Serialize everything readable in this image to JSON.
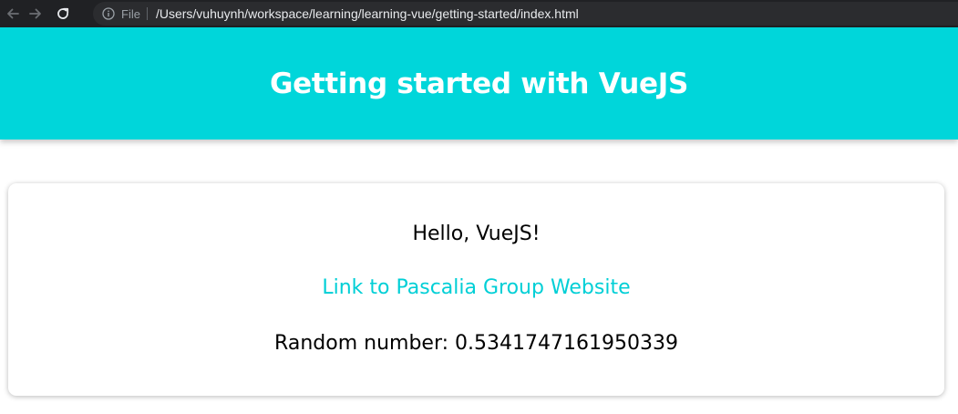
{
  "browser": {
    "scheme_label": "File",
    "url": "/Users/vuhuynh/workspace/learning/learning-vue/getting-started/index.html",
    "icons": {
      "back": "arrow-left-icon",
      "forward": "arrow-right-icon",
      "reload": "reload-icon",
      "info": "info-icon"
    }
  },
  "header": {
    "title": "Getting started with VueJS",
    "background_color": "#00d6da"
  },
  "card": {
    "greeting": "Hello, VueJS!",
    "link_label": "Link to Pascalia Group Website",
    "link_color": "#00cfd6",
    "random_label": "Random number: 0.5341747161950339"
  }
}
